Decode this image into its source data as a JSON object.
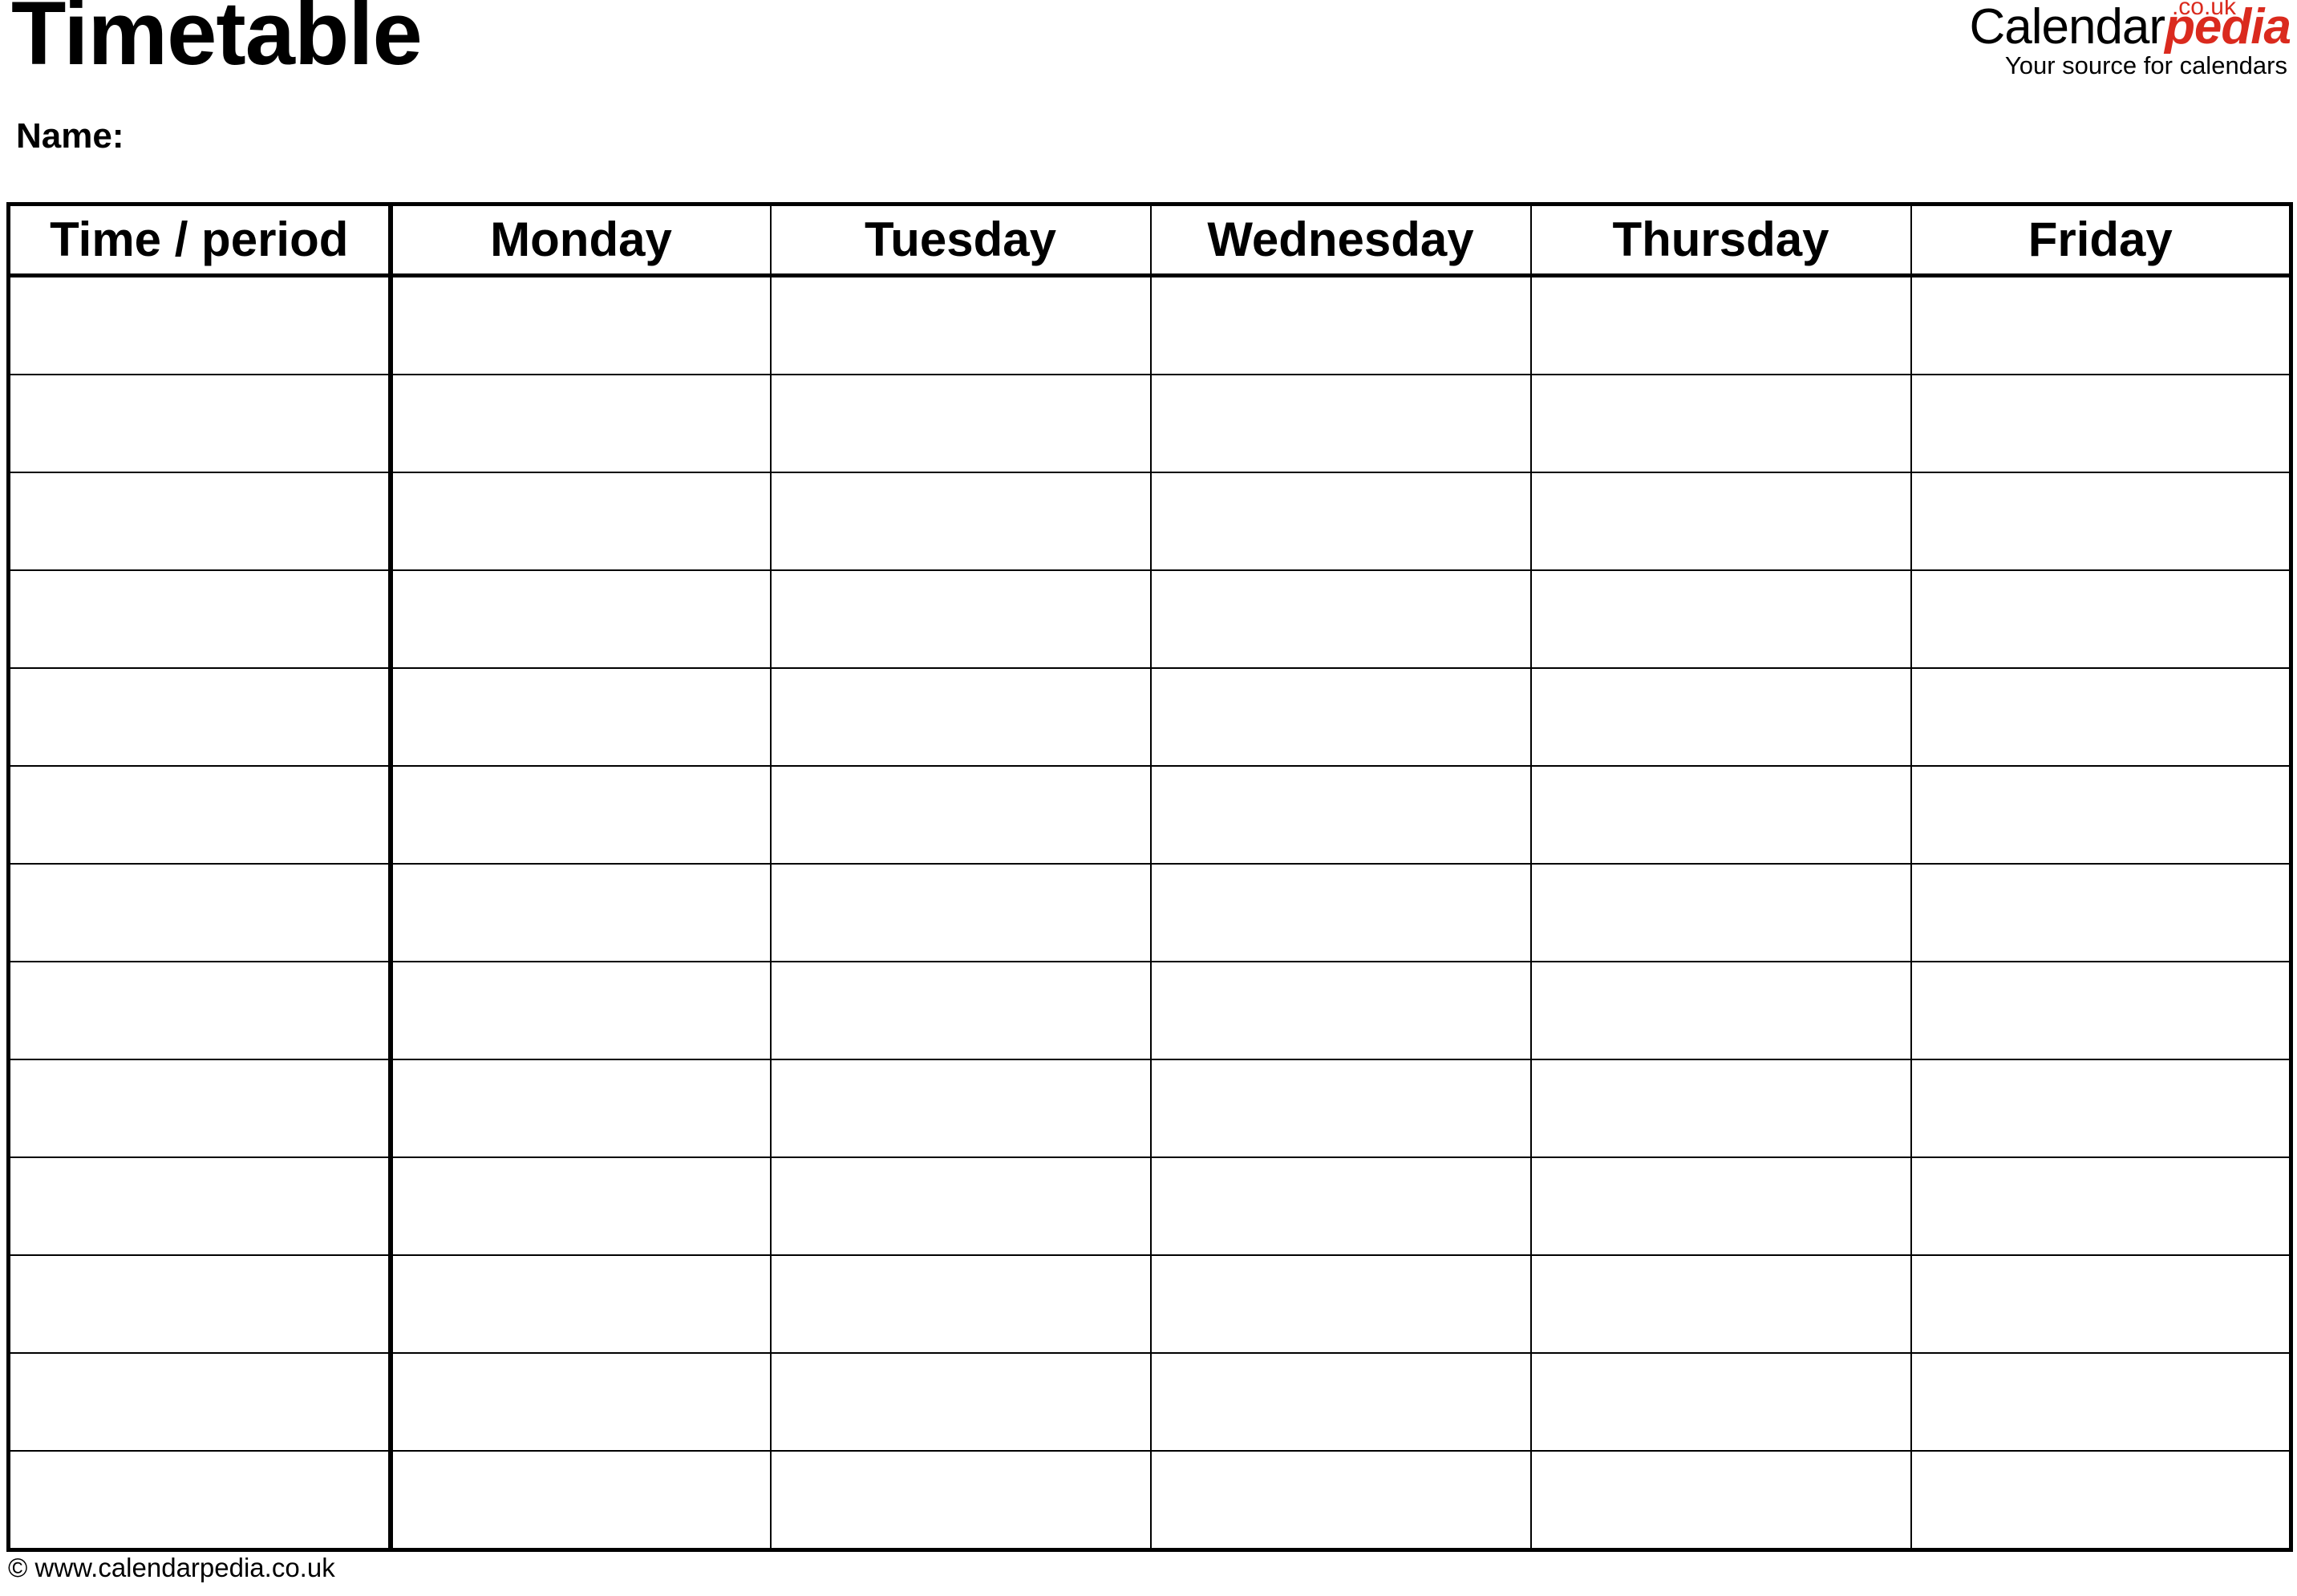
{
  "document": {
    "title": "Timetable",
    "name_label": "Name:"
  },
  "logo": {
    "brand_primary": "Calendar",
    "brand_secondary": "pedia",
    "tld": ".co.uk",
    "tagline": "Your source for calendars",
    "accent_color": "#DA2A1E",
    "primary_color": "#000000"
  },
  "table": {
    "columns": [
      "Time / period",
      "Monday",
      "Tuesday",
      "Wednesday",
      "Thursday",
      "Friday"
    ],
    "row_count": 13,
    "rows": [
      [
        "",
        "",
        "",
        "",
        "",
        ""
      ],
      [
        "",
        "",
        "",
        "",
        "",
        ""
      ],
      [
        "",
        "",
        "",
        "",
        "",
        ""
      ],
      [
        "",
        "",
        "",
        "",
        "",
        ""
      ],
      [
        "",
        "",
        "",
        "",
        "",
        ""
      ],
      [
        "",
        "",
        "",
        "",
        "",
        ""
      ],
      [
        "",
        "",
        "",
        "",
        "",
        ""
      ],
      [
        "",
        "",
        "",
        "",
        "",
        ""
      ],
      [
        "",
        "",
        "",
        "",
        "",
        ""
      ],
      [
        "",
        "",
        "",
        "",
        "",
        ""
      ],
      [
        "",
        "",
        "",
        "",
        "",
        ""
      ],
      [
        "",
        "",
        "",
        "",
        "",
        ""
      ],
      [
        "",
        "",
        "",
        "",
        "",
        ""
      ]
    ]
  },
  "footer": {
    "credit": "© www.calendarpedia.co.uk"
  }
}
